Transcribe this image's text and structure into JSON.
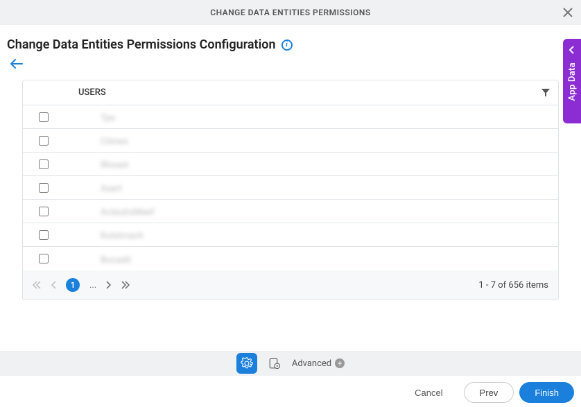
{
  "header": {
    "title": "CHANGE DATA ENTITIES PERMISSIONS"
  },
  "subtitle": "Change Data Entities Permissions Configuration",
  "table": {
    "column_header": "USERS",
    "rows": [
      {
        "name": "Tps"
      },
      {
        "name": "Cilmes"
      },
      {
        "name": "Rhoast"
      },
      {
        "name": "Asert"
      },
      {
        "name": "ActeulrsMeef"
      },
      {
        "name": "Kolstmach"
      },
      {
        "name": "Bocadit"
      }
    ]
  },
  "pagination": {
    "current_page": "1",
    "ellipsis": "...",
    "summary": "1 - 7 of 656 items"
  },
  "side_panel": {
    "label": "App Data"
  },
  "toolbar": {
    "advanced_label": "Advanced"
  },
  "actions": {
    "cancel": "Cancel",
    "prev": "Prev",
    "finish": "Finish"
  }
}
